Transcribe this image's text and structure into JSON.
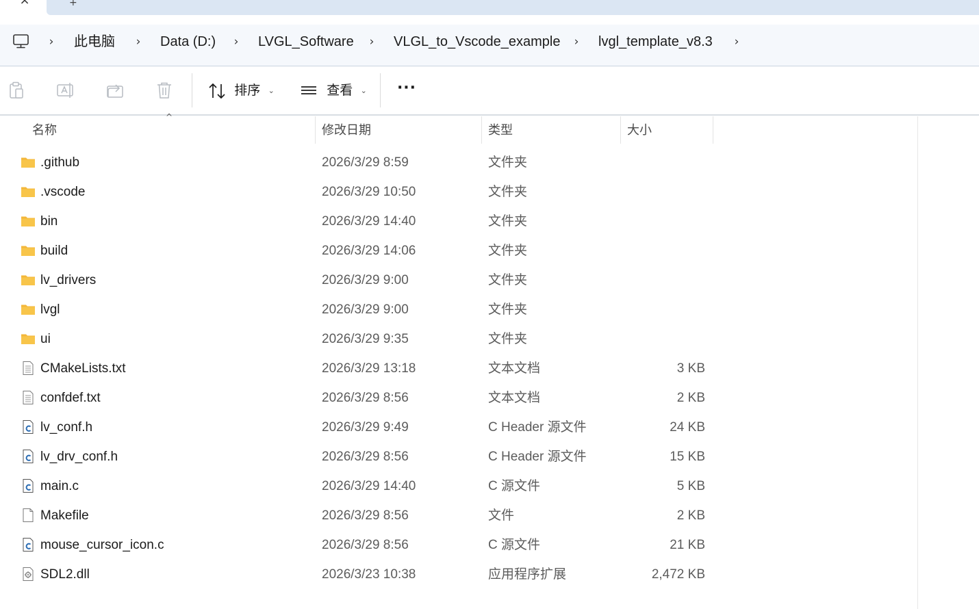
{
  "tabbar": {
    "close_glyph": "×",
    "new_tab_glyph": "+"
  },
  "address": {
    "root_icon": "computer-icon",
    "crumbs": [
      "此电脑",
      "Data (D:)",
      "LVGL_Software",
      "VLGL_to_Vscode_example",
      "lvgl_template_v8.3"
    ],
    "chevron": "›"
  },
  "toolbar": {
    "icons": [
      "paste-icon",
      "rename-icon",
      "share-icon",
      "delete-icon"
    ],
    "sort_label": "排序",
    "view_label": "查看",
    "more_glyph": "···",
    "caret": "⌄"
  },
  "columns": {
    "name": "名称",
    "modified": "修改日期",
    "type": "类型",
    "size": "大小",
    "sort_indicator": "^"
  },
  "files": [
    {
      "name": ".github",
      "date": "2026/3/29 8:59",
      "type": "文件夹",
      "size": "",
      "icon": "folder-icon"
    },
    {
      "name": ".vscode",
      "date": "2026/3/29 10:50",
      "type": "文件夹",
      "size": "",
      "icon": "folder-icon"
    },
    {
      "name": "bin",
      "date": "2026/3/29 14:40",
      "type": "文件夹",
      "size": "",
      "icon": "folder-icon"
    },
    {
      "name": "build",
      "date": "2026/3/29 14:06",
      "type": "文件夹",
      "size": "",
      "icon": "folder-icon"
    },
    {
      "name": "lv_drivers",
      "date": "2026/3/29 9:00",
      "type": "文件夹",
      "size": "",
      "icon": "folder-icon"
    },
    {
      "name": "lvgl",
      "date": "2026/3/29 9:00",
      "type": "文件夹",
      "size": "",
      "icon": "folder-icon"
    },
    {
      "name": "ui",
      "date": "2026/3/29 9:35",
      "type": "文件夹",
      "size": "",
      "icon": "folder-icon"
    },
    {
      "name": "CMakeLists.txt",
      "date": "2026/3/29 13:18",
      "type": "文本文档",
      "size": "3 KB",
      "icon": "text-file-icon"
    },
    {
      "name": "confdef.txt",
      "date": "2026/3/29 8:56",
      "type": "文本文档",
      "size": "2 KB",
      "icon": "text-file-icon"
    },
    {
      "name": "lv_conf.h",
      "date": "2026/3/29 9:49",
      "type": "C Header 源文件",
      "size": "24 KB",
      "icon": "c-file-icon"
    },
    {
      "name": "lv_drv_conf.h",
      "date": "2026/3/29 8:56",
      "type": "C Header 源文件",
      "size": "15 KB",
      "icon": "c-file-icon"
    },
    {
      "name": "main.c",
      "date": "2026/3/29 14:40",
      "type": "C 源文件",
      "size": "5 KB",
      "icon": "c-file-icon"
    },
    {
      "name": "Makefile",
      "date": "2026/3/29 8:56",
      "type": "文件",
      "size": "2 KB",
      "icon": "blank-file-icon"
    },
    {
      "name": "mouse_cursor_icon.c",
      "date": "2026/3/29 8:56",
      "type": "C 源文件",
      "size": "21 KB",
      "icon": "c-file-icon"
    },
    {
      "name": "SDL2.dll",
      "date": "2026/3/23 10:38",
      "type": "应用程序扩展",
      "size": "2,472 KB",
      "icon": "dll-file-icon"
    }
  ],
  "colors": {
    "folder": "#f8c54a",
    "c_accent": "#2b6cb3",
    "address_bg": "#f5f8fc",
    "tab_bg": "#dbe6f3"
  }
}
